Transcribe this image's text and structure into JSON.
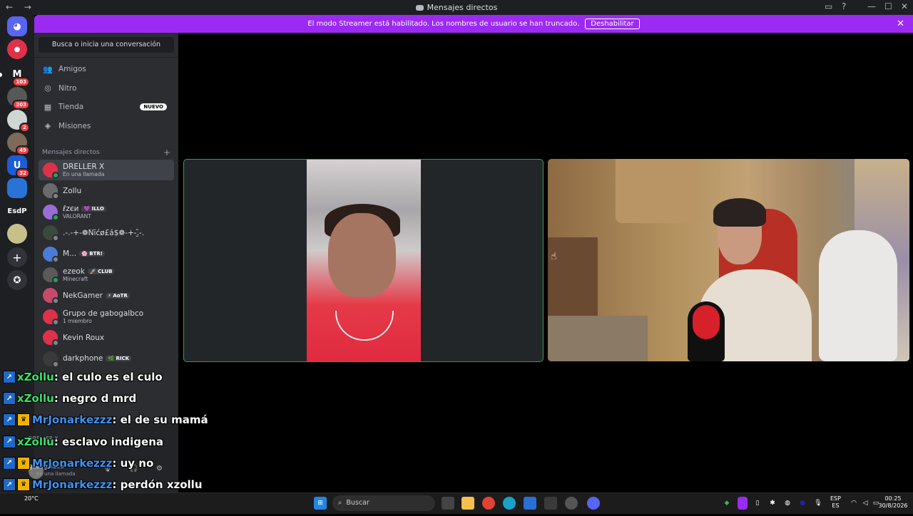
{
  "window": {
    "title": "Mensajes directos",
    "nav": "← →",
    "controls": [
      "▭",
      "?",
      "—",
      "☐",
      "✕"
    ]
  },
  "banner": {
    "text": "El modo Streamer está habilitado. Los nombres de usuario se han truncado.",
    "button": "Deshabilitar",
    "close": "✕"
  },
  "servers": [
    {
      "label": "",
      "badge": "103",
      "color": "#1e1f22",
      "letter": "M"
    },
    {
      "label": "",
      "badge": "203",
      "color": "#585858",
      "letter": ""
    },
    {
      "label": "",
      "badge": "2",
      "color": "#cfd7d4",
      "letter": ""
    },
    {
      "label": "",
      "badge": "49",
      "color": "#7d6a5a",
      "letter": ""
    },
    {
      "label": "",
      "badge": "32",
      "color": "#1e5bd6",
      "letter": "U"
    },
    {
      "label": "",
      "badge": "",
      "color": "#2a73d6",
      "letter": ""
    },
    {
      "label": "EsdP",
      "badge": "",
      "color": "#1e1f22",
      "letter": "EsdP"
    },
    {
      "label": "",
      "badge": "",
      "color": "#c8c08b",
      "letter": ""
    }
  ],
  "dm_panel": {
    "search_label": "Busca o inicia una conversación",
    "nav": [
      {
        "label": "Amigos",
        "icon": "friends-icon",
        "glyph": "👥"
      },
      {
        "label": "Nitro",
        "icon": "nitro-icon",
        "glyph": "◎"
      },
      {
        "label": "Tienda",
        "icon": "store-icon",
        "glyph": "▦",
        "badge": "NUEVO"
      },
      {
        "label": "Misiones",
        "icon": "quests-icon",
        "glyph": "◈"
      }
    ],
    "section_title": "Mensajes directos",
    "section_plus": "+",
    "dms": [
      {
        "name": "DRELLER X",
        "sub": "En una llamada",
        "tag": "",
        "color": "#e0314a",
        "online": true
      },
      {
        "name": "Zollu",
        "sub": "",
        "tag": "",
        "color": "#6a6a6a",
        "online": false
      },
      {
        "name": "ℓzєи",
        "sub": "VALORANT",
        "tag": "💜 ILLO",
        "color": "#9a6cd6",
        "online": true
      },
      {
        "name": ".-.-+-❁Ńĭćø£á$❁-+-.̮̑-.",
        "sub": "",
        "tag": "",
        "color": "#3a4a3a",
        "online": false
      },
      {
        "name": "M...",
        "sub": "",
        "tag": "🌸 BTR!",
        "color": "#4c7bd6",
        "online": false
      },
      {
        "name": "ezeok",
        "sub": "Minecraft",
        "tag": "🚀 CLUB",
        "color": "#5a5a5a",
        "online": true
      },
      {
        "name": "NekGamer",
        "sub": "",
        "tag": "⚡ AoTR",
        "color": "#c84a6a",
        "online": false
      },
      {
        "name": "Grupo de gabogalbco",
        "sub": "1 miembro",
        "tag": "",
        "color": "#e0314a",
        "online": false
      },
      {
        "name": "Kevin Roux",
        "sub": "",
        "tag": "",
        "color": "#e0314a",
        "online": false
      },
      {
        "name": "darkphone",
        "sub": "",
        "tag": "🌿 RICK",
        "color": "#3a3a3a",
        "online": false
      }
    ],
    "voice": {
      "user": "DRELLER X"
    },
    "user": {
      "name": "gabogalbco",
      "status": "En una llamada"
    }
  },
  "chat": [
    {
      "user": "xZollu",
      "msg": ": el culo es el culo",
      "color": "green",
      "badges": 1
    },
    {
      "user": "xZollu",
      "msg": ": negro d mrd",
      "color": "green",
      "badges": 1
    },
    {
      "user": "MrJonarkezzz",
      "msg": ": el de su mamá",
      "color": "blue",
      "badges": 2
    },
    {
      "user": "xZollu",
      "msg": ": esclavo indigena",
      "color": "green",
      "badges": 1
    },
    {
      "user": "MrJonarkezzz",
      "msg": ": uy no",
      "color": "blue",
      "badges": 2
    },
    {
      "user": "MrJonarkezzz",
      "msg": ": perdón xzollu",
      "color": "blue",
      "badges": 2
    },
    {
      "user": "MrJonarkezzz",
      "msg": ":",
      "color": "blue",
      "badges": 2
    }
  ],
  "taskbar": {
    "search": "Buscar",
    "weather": "20°C",
    "lang": "ESP",
    "lang2": "ES",
    "time": "00:25",
    "date": "30/8/2026"
  }
}
